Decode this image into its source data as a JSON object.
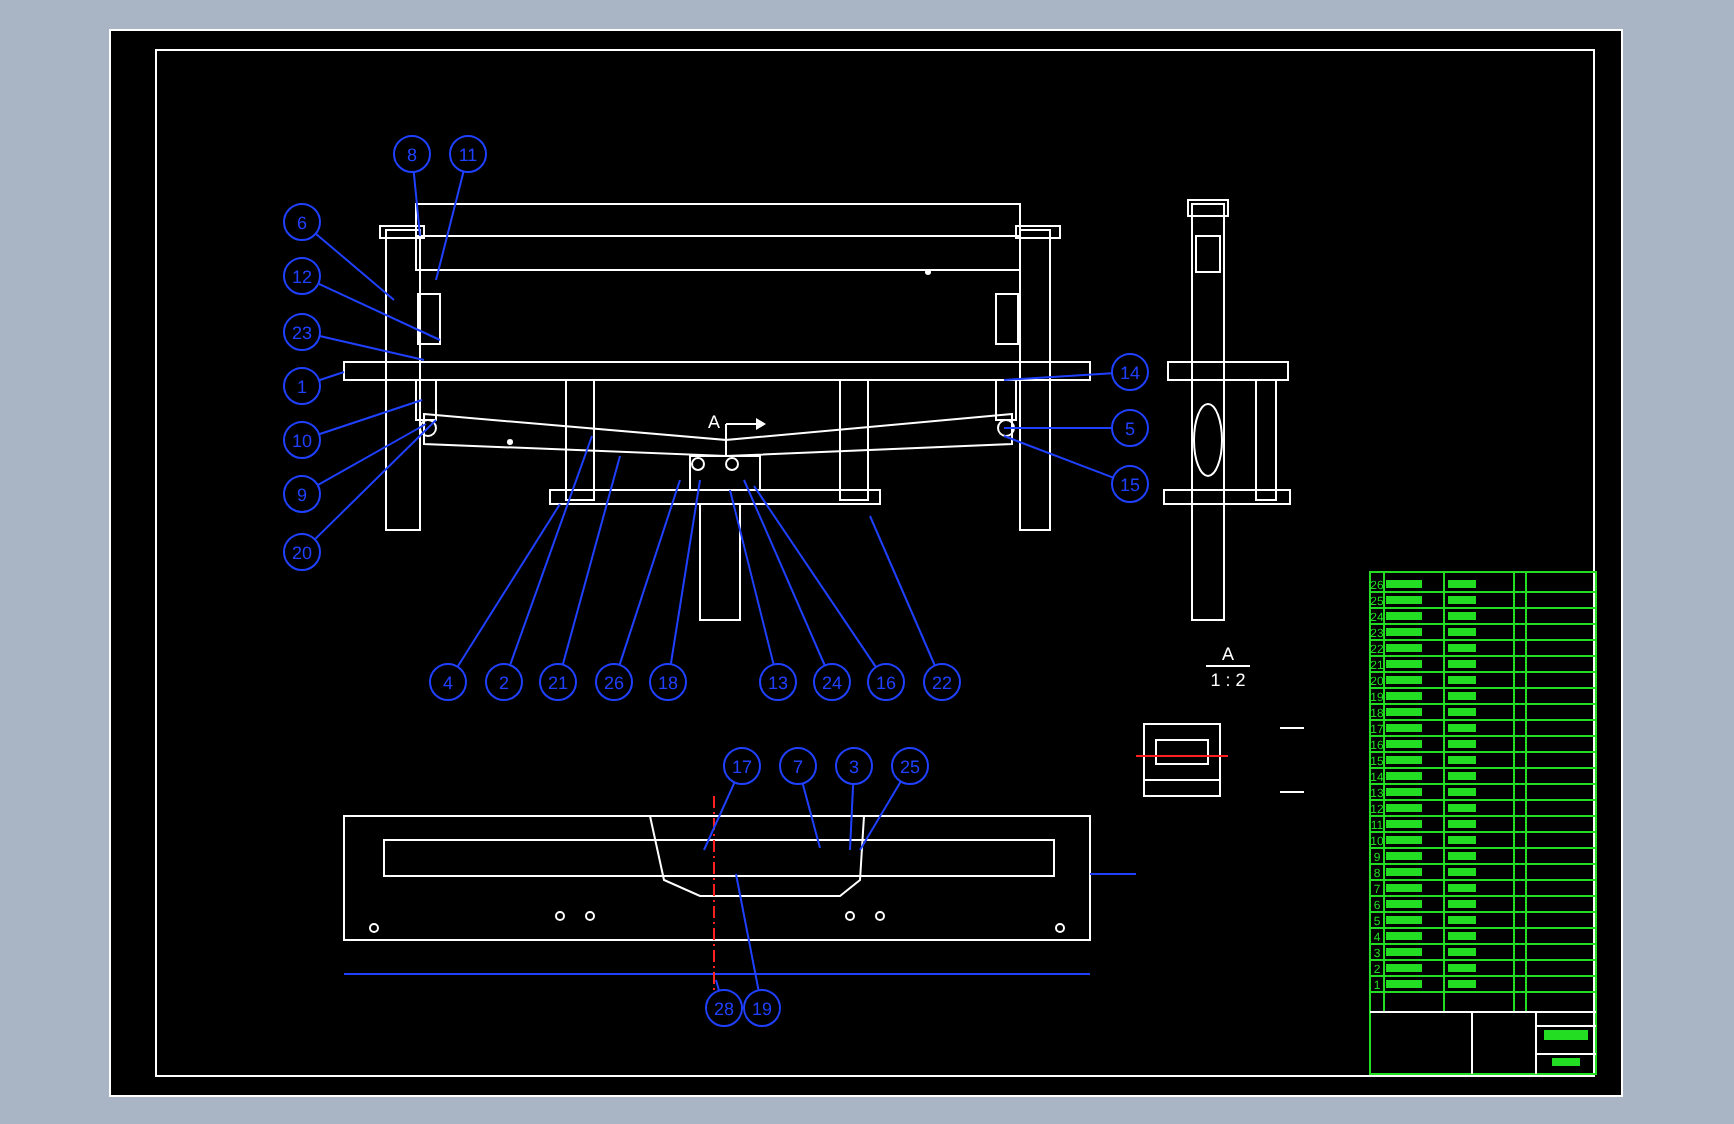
{
  "balloons": [
    "8",
    "11",
    "6",
    "12",
    "23",
    "1",
    "10",
    "9",
    "20",
    "14",
    "5",
    "15",
    "4",
    "2",
    "21",
    "26",
    "18",
    "13",
    "24",
    "16",
    "22",
    "17",
    "7",
    "3",
    "25",
    "28",
    "19"
  ],
  "section_marker": "A",
  "section_title": {
    "name": "A",
    "scale": "1 : 2"
  },
  "parts_list": {
    "item_numbers": [
      "26",
      "25",
      "24",
      "23",
      "22",
      "21",
      "20",
      "19",
      "18",
      "17",
      "16",
      "15",
      "14",
      "13",
      "12",
      "11",
      "10",
      "9",
      "8",
      "7",
      "6",
      "5",
      "4",
      "3",
      "2",
      "1"
    ]
  }
}
